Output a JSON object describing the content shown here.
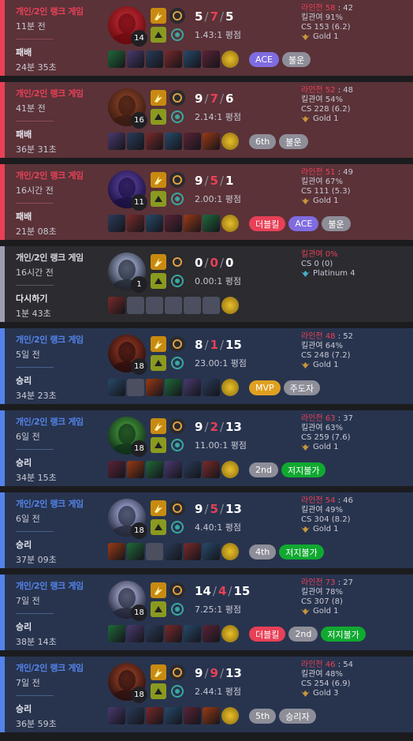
{
  "colors": {
    "loss_bg": "#5a3238",
    "win_bg": "#28344e",
    "remake_bg": "#2b2b30",
    "loss_accent": "#e84057",
    "win_accent": "#5383e8",
    "badge_ace": "#7f6ce0",
    "badge_mvp": "#e0a020",
    "badge_green": "#10a930"
  },
  "matches": [
    {
      "outcome": "loss",
      "queue": "개인/2인 랭크 게임",
      "ago": "11분 전",
      "result": "패배",
      "duration": "24분 35초",
      "level": "14",
      "kills": "5",
      "deaths": "7",
      "assists": "5",
      "kda_ratio": "1.43:1 평점",
      "lane_label": "라인전",
      "lane_for": "58",
      "lane_against": "42",
      "kill_participation": "킬관여 91%",
      "cs": "CS 153 (6.2)",
      "rank": "Gold 1",
      "rank_icon": "gold-wings-icon",
      "items_count": 7,
      "items_empty": [],
      "badges": [
        {
          "label": "ACE",
          "style": "ace"
        },
        {
          "label": "불운",
          "style": "gray"
        }
      ]
    },
    {
      "outcome": "loss",
      "queue": "개인/2인 랭크 게임",
      "ago": "41분 전",
      "result": "패배",
      "duration": "36분 31초",
      "level": "16",
      "kills": "9",
      "deaths": "7",
      "assists": "6",
      "kda_ratio": "2.14:1 평점",
      "lane_label": "라인전",
      "lane_for": "52",
      "lane_against": "48",
      "kill_participation": "킬관여 54%",
      "cs": "CS 228 (6.2)",
      "rank": "Gold 1",
      "rank_icon": "gold-wings-icon",
      "items_count": 7,
      "items_empty": [],
      "badges": [
        {
          "label": "6th",
          "style": "gray"
        },
        {
          "label": "불운",
          "style": "gray"
        }
      ]
    },
    {
      "outcome": "loss",
      "queue": "개인/2인 랭크 게임",
      "ago": "16시간 전",
      "result": "패배",
      "duration": "21분 08초",
      "level": "11",
      "kills": "9",
      "deaths": "5",
      "assists": "1",
      "kda_ratio": "2.00:1 평점",
      "lane_label": "라인전",
      "lane_for": "51",
      "lane_against": "49",
      "kill_participation": "킬관여 67%",
      "cs": "CS 111 (5.3)",
      "rank": "Gold 1",
      "rank_icon": "gold-wings-icon",
      "items_count": 7,
      "items_empty": [],
      "badges": [
        {
          "label": "더블킬",
          "style": "red"
        },
        {
          "label": "ACE",
          "style": "ace"
        },
        {
          "label": "불운",
          "style": "gray"
        }
      ]
    },
    {
      "outcome": "remake",
      "queue": "개인/2인 랭크 게임",
      "ago": "16시간 전",
      "result": "다시하기",
      "duration": "1분 43초",
      "level": "1",
      "kills": "0",
      "deaths": "0",
      "assists": "0",
      "kda_ratio": "0.00:1 평점",
      "lane_label": "",
      "lane_for": "",
      "lane_against": "",
      "kill_participation": "킬관여 0%",
      "cs": "CS 0 (0)",
      "rank": "Platinum 4",
      "rank_icon": "platinum-wings-icon",
      "items_count": 7,
      "items_empty": [
        1,
        2,
        3,
        4,
        5
      ],
      "badges": []
    },
    {
      "outcome": "win",
      "queue": "개인/2인 랭크 게임",
      "ago": "5일 전",
      "result": "승리",
      "duration": "34분 23초",
      "level": "18",
      "kills": "8",
      "deaths": "1",
      "assists": "15",
      "kda_ratio": "23.00:1 평점",
      "lane_label": "라인전",
      "lane_for": "48",
      "lane_against": "52",
      "kill_participation": "킬관여 64%",
      "cs": "CS 248 (7.2)",
      "rank": "Gold 1",
      "rank_icon": "gold-wings-icon",
      "items_count": 7,
      "items_empty": [
        1
      ],
      "badges": [
        {
          "label": "MVP",
          "style": "mvp"
        },
        {
          "label": "주도자",
          "style": "gray"
        }
      ]
    },
    {
      "outcome": "win",
      "queue": "개인/2인 랭크 게임",
      "ago": "6일 전",
      "result": "승리",
      "duration": "34분 15초",
      "level": "18",
      "kills": "9",
      "deaths": "2",
      "assists": "13",
      "kda_ratio": "11.00:1 평점",
      "lane_label": "라인전",
      "lane_for": "63",
      "lane_against": "37",
      "kill_participation": "킬관여 63%",
      "cs": "CS 259 (7.6)",
      "rank": "Gold 1",
      "rank_icon": "gold-wings-icon",
      "items_count": 7,
      "items_empty": [],
      "badges": [
        {
          "label": "2nd",
          "style": "gray"
        },
        {
          "label": "저지불가",
          "style": "green"
        }
      ]
    },
    {
      "outcome": "win",
      "queue": "개인/2인 랭크 게임",
      "ago": "6일 전",
      "result": "승리",
      "duration": "37분 09초",
      "level": "18",
      "kills": "9",
      "deaths": "5",
      "assists": "13",
      "kda_ratio": "4.40:1 평점",
      "lane_label": "라인전",
      "lane_for": "54",
      "lane_against": "46",
      "kill_participation": "킬관여 49%",
      "cs": "CS 304 (8.2)",
      "rank": "Gold 1",
      "rank_icon": "gold-wings-icon",
      "items_count": 7,
      "items_empty": [
        2
      ],
      "badges": [
        {
          "label": "4th",
          "style": "gray"
        },
        {
          "label": "저지불가",
          "style": "green"
        }
      ]
    },
    {
      "outcome": "win",
      "queue": "개인/2인 랭크 게임",
      "ago": "7일 전",
      "result": "승리",
      "duration": "38분 14초",
      "level": "18",
      "kills": "14",
      "deaths": "4",
      "assists": "15",
      "kda_ratio": "7.25:1 평점",
      "lane_label": "라인전",
      "lane_for": "73",
      "lane_against": "27",
      "kill_participation": "킬관여 78%",
      "cs": "CS 307 (8)",
      "rank": "Gold 1",
      "rank_icon": "gold-wings-icon",
      "items_count": 7,
      "items_empty": [],
      "badges": [
        {
          "label": "더블킬",
          "style": "red"
        },
        {
          "label": "2nd",
          "style": "gray"
        },
        {
          "label": "저지불가",
          "style": "green"
        }
      ]
    },
    {
      "outcome": "win",
      "queue": "개인/2인 랭크 게임",
      "ago": "7일 전",
      "result": "승리",
      "duration": "36분 59초",
      "level": "18",
      "kills": "9",
      "deaths": "9",
      "assists": "13",
      "kda_ratio": "2.44:1 평점",
      "lane_label": "라인전",
      "lane_for": "46",
      "lane_against": "54",
      "kill_participation": "킬관여 48%",
      "cs": "CS 254 (6.9)",
      "rank": "Gold 3",
      "rank_icon": "gold-wings-icon",
      "items_count": 7,
      "items_empty": [],
      "badges": [
        {
          "label": "5th",
          "style": "gray"
        },
        {
          "label": "승리자",
          "style": "gray"
        }
      ]
    }
  ]
}
